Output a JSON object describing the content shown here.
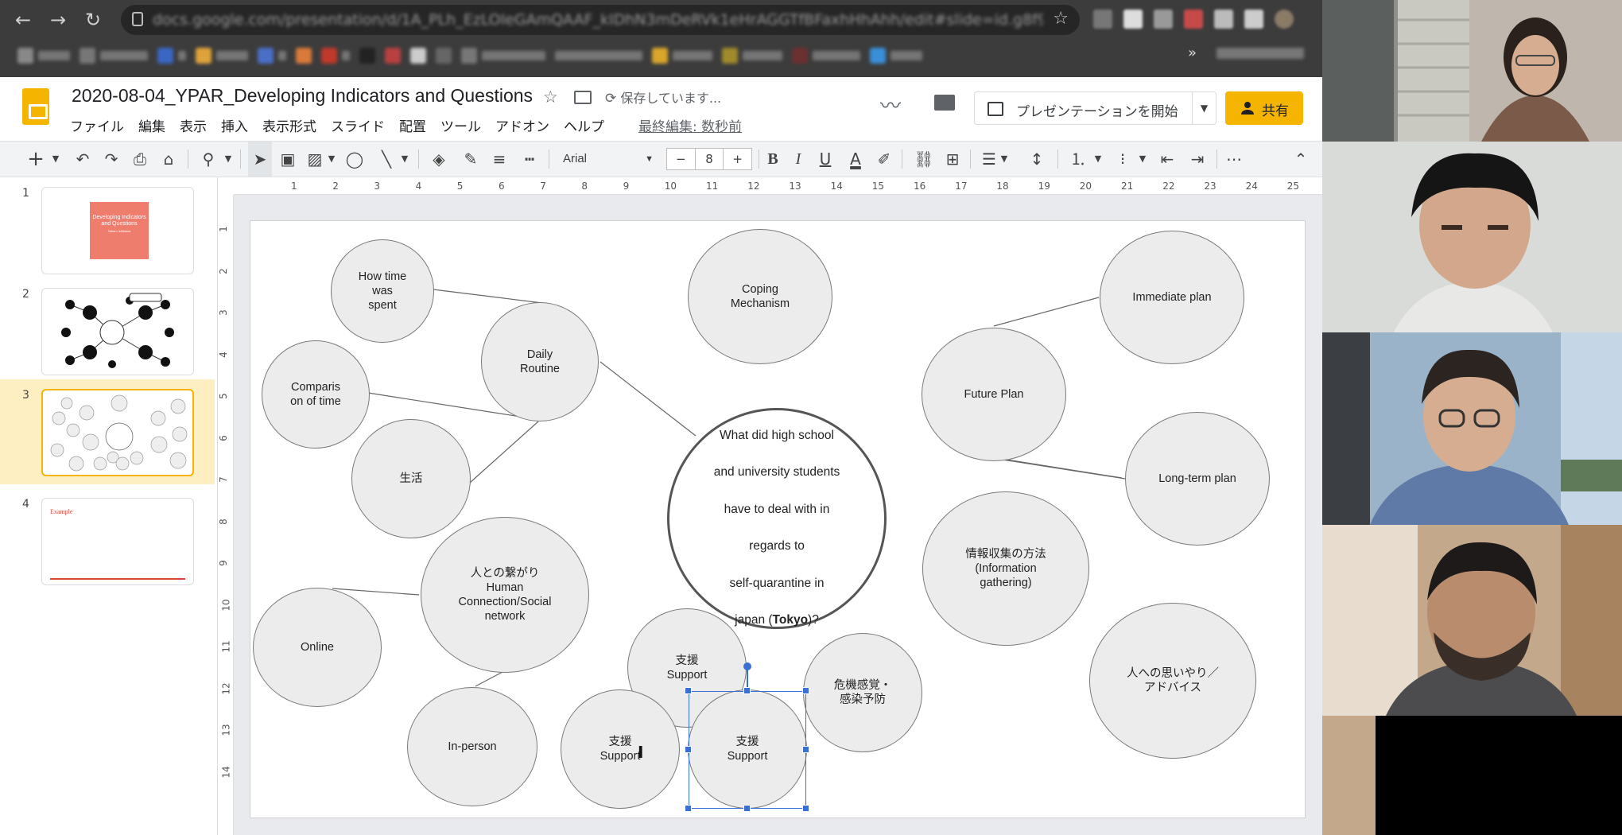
{
  "browser": {
    "url": "docs.google.com/presentation/d/1A_PLh_EzLOIeGAmQAAF_kIDhN3mDeRVk1eHrAGGTfBFaxhHhAhh/edit#slide=id.g8f9cf5d286_",
    "back_icon": "arrow-left-icon",
    "forward_icon": "arrow-right-icon",
    "reload_icon": "reload-icon"
  },
  "app": {
    "title": "2020-08-04_YPAR_Developing Indicators and Questions",
    "saving_status": "保存しています...",
    "menus": [
      "ファイル",
      "編集",
      "表示",
      "挿入",
      "表示形式",
      "スライド",
      "配置",
      "ツール",
      "アドオン",
      "ヘルプ"
    ],
    "last_edit": "最終編集: 数秒前",
    "present_label": "プレゼンテーションを開始",
    "share_label": "共有",
    "brand_color": "#f4b400"
  },
  "toolbar": {
    "font": "Arial",
    "font_size": "8",
    "minus": "−",
    "plus": "+"
  },
  "ruler": {
    "horizontal": [
      "1",
      "2",
      "3",
      "4",
      "5",
      "6",
      "7",
      "8",
      "9",
      "10",
      "11",
      "12",
      "13",
      "14",
      "15",
      "16",
      "17",
      "18",
      "19",
      "20",
      "21",
      "22",
      "23",
      "24",
      "25"
    ],
    "vertical": [
      "1",
      "2",
      "3",
      "4",
      "5",
      "6",
      "7",
      "8",
      "9",
      "10",
      "11",
      "12",
      "13",
      "14"
    ]
  },
  "filmstrip": {
    "slides": [
      {
        "num": "1",
        "title": "Developing Indicators and Questions",
        "author": "Takuro Ishikawa"
      },
      {
        "num": "2"
      },
      {
        "num": "3"
      },
      {
        "num": "4",
        "title": "Example"
      }
    ],
    "selected": 3
  },
  "slide": {
    "center": {
      "line1": "What did high school",
      "line2": "and university students",
      "line3": "have to deal with in",
      "line4": "regards to",
      "line5": "self-quarantine in",
      "line6a": "japan (",
      "line6b": "Tokyo",
      "line6c": ")?"
    },
    "bubbles": {
      "how_time": "How time\nwas\nspent",
      "daily_routine": "Daily\nRoutine",
      "comparison": "Comparis\non of time",
      "seikatsu": "生活",
      "human_connection": "人との繋がり\nHuman\nConnection/Social\nnetwork",
      "online": "Online",
      "in_person": "In-person",
      "coping": "Coping\nMechanism",
      "support_top": "支援\nSupport",
      "support_left": "支援\nSupport",
      "support_selected": "支援\nSupport",
      "kiki": "危機感覚・\n感染予防",
      "future_plan": "Future Plan",
      "immediate_plan": "Immediate plan",
      "long_term_plan": "Long-term plan",
      "info_gathering": "情報収集の方法\n(Information\ngathering)",
      "omoiyari": "人への思いやり／\nアドバイス"
    }
  },
  "video": {
    "participants": [
      "participant-1",
      "participant-2",
      "participant-3",
      "participant-4"
    ]
  }
}
